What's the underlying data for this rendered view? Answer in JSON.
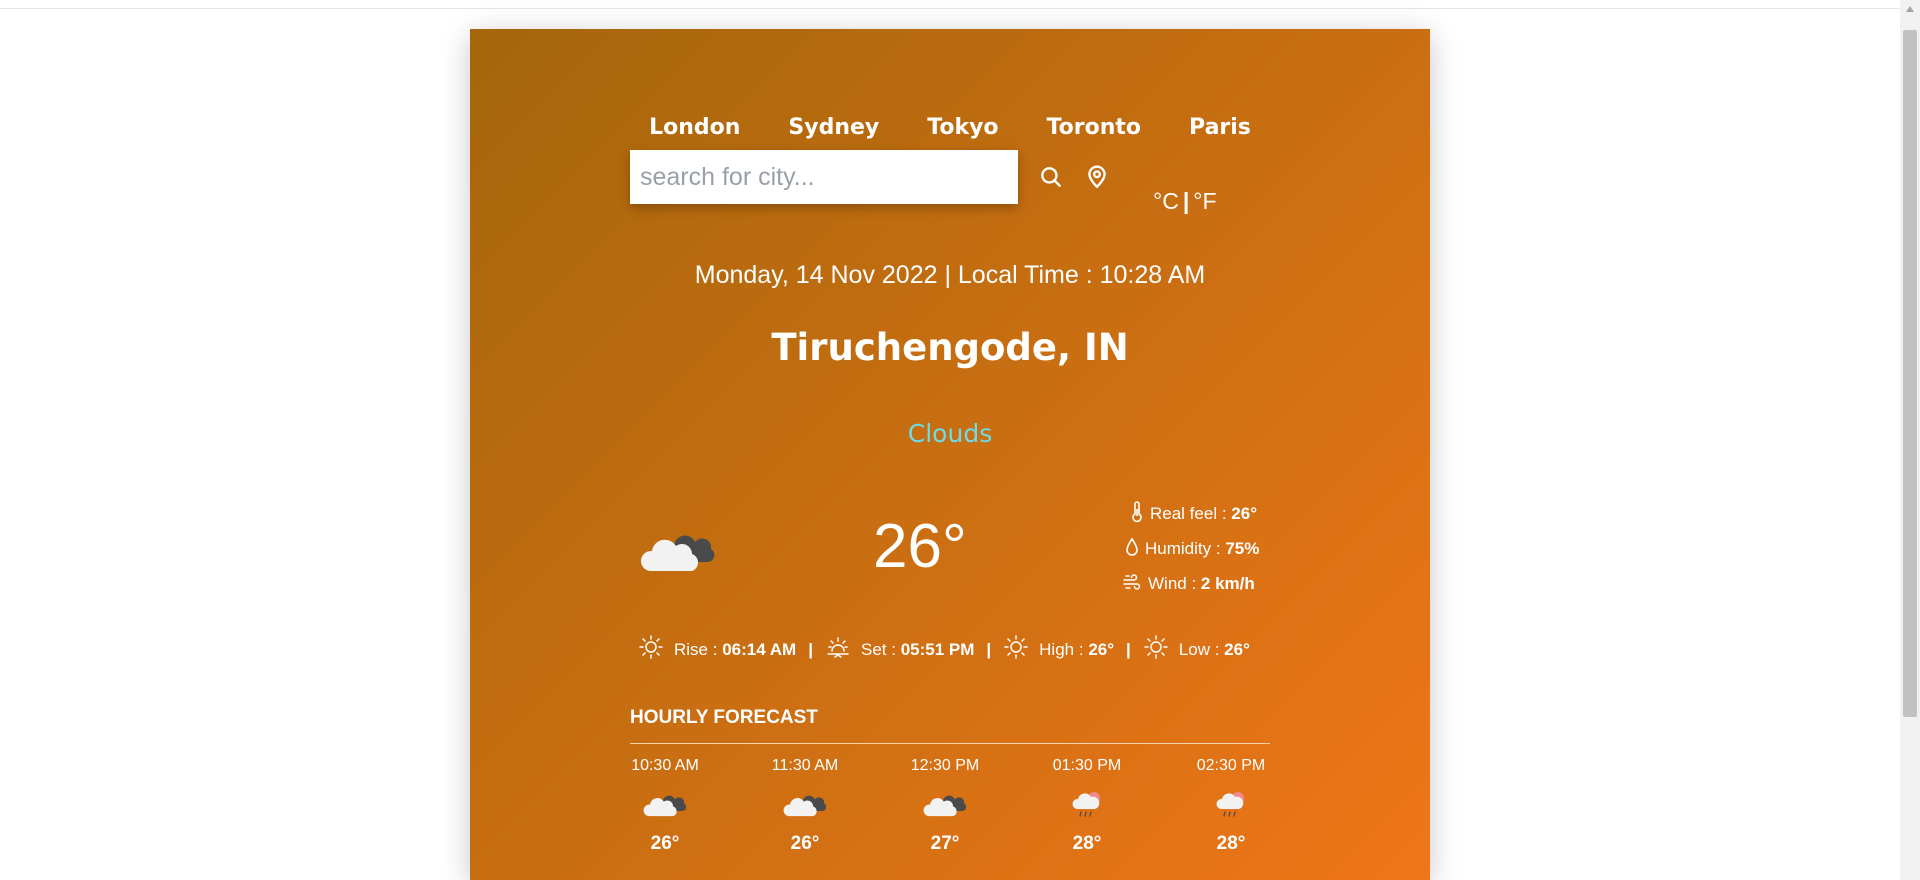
{
  "nav": {
    "cities": [
      "London",
      "Sydney",
      "Tokyo",
      "Toronto",
      "Paris"
    ]
  },
  "search": {
    "placeholder": "search for city...",
    "search_icon": "search-icon",
    "location_icon": "map-pin-icon"
  },
  "units": {
    "celsius": "°C",
    "separator": "|",
    "fahrenheit": "°F"
  },
  "datetime": "Monday, 14 Nov 2022 | Local Time : 10:28 AM",
  "location": "Tiruchengode, IN",
  "condition": "Clouds",
  "current": {
    "icon": "cloud-icon",
    "temperature": "26°",
    "real_feel_label": "Real feel :",
    "real_feel_value": "26°",
    "humidity_label": "Humidity :",
    "humidity_value": "75%",
    "wind_label": "Wind :",
    "wind_value": "2 km/h"
  },
  "sun": {
    "rise_label": "Rise :",
    "rise_value": "06:14 AM",
    "set_label": "Set :",
    "set_value": "05:51 PM",
    "high_label": "High :",
    "high_value": "26°",
    "low_label": "Low :",
    "low_value": "26°",
    "separator": "|"
  },
  "hourly": {
    "title": "HOURLY FORECAST",
    "items": [
      {
        "time": "10:30 AM",
        "icon": "cloud-icon",
        "temp": "26°"
      },
      {
        "time": "11:30 AM",
        "icon": "cloud-icon",
        "temp": "26°"
      },
      {
        "time": "12:30 PM",
        "icon": "cloud-icon",
        "temp": "27°"
      },
      {
        "time": "01:30 PM",
        "icon": "rain-cloud-icon",
        "temp": "28°"
      },
      {
        "time": "02:30 PM",
        "icon": "rain-cloud-icon",
        "temp": "28°"
      }
    ]
  },
  "colors": {
    "gradient_start": "#a5660a",
    "gradient_end": "#ef7618",
    "condition_text": "#6fdbe6"
  }
}
